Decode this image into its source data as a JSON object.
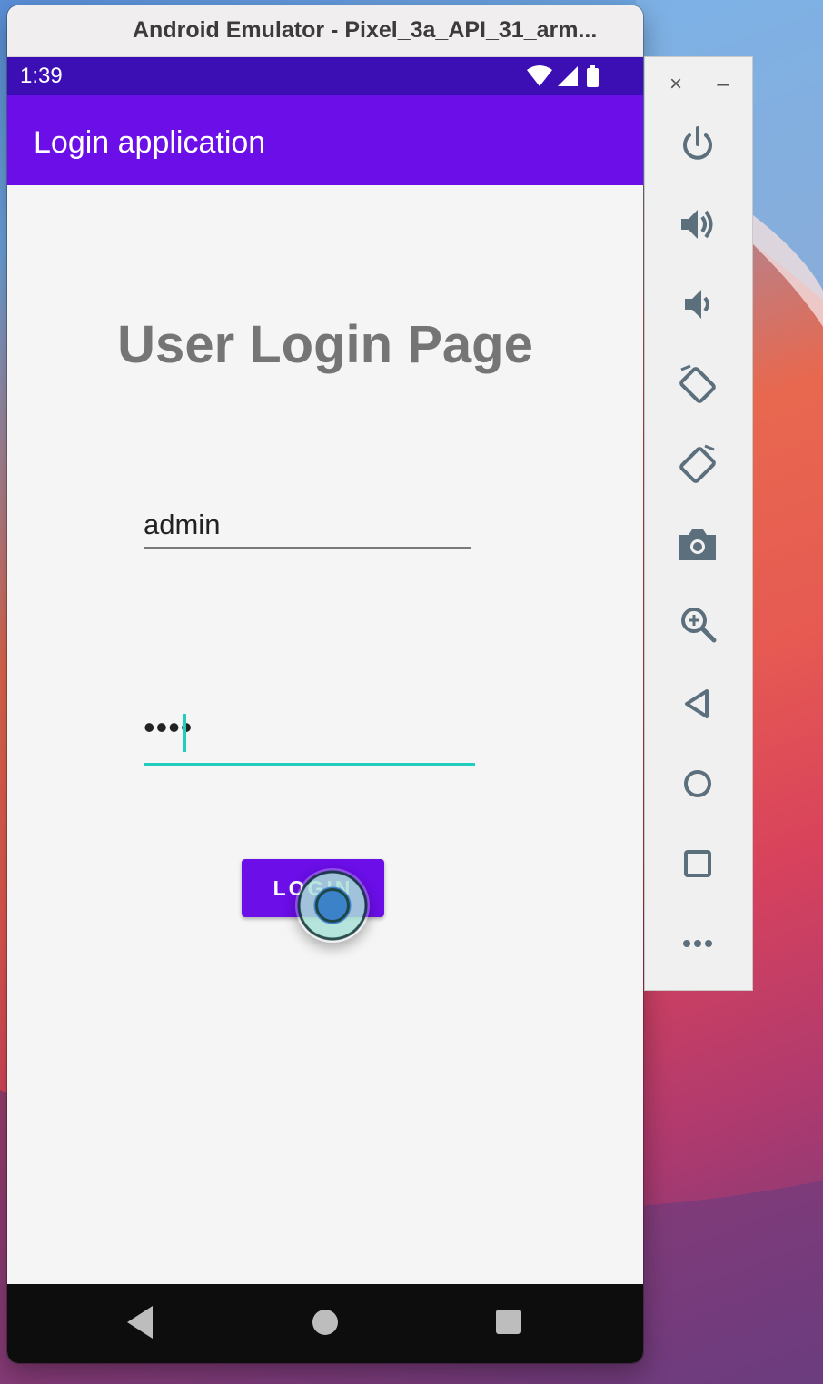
{
  "window": {
    "title": "Android Emulator - Pixel_3a_API_31_arm..."
  },
  "status_bar": {
    "time": "1:39",
    "icons": [
      "wifi-icon",
      "signal-icon",
      "battery-icon"
    ]
  },
  "app_bar": {
    "title": "Login application",
    "color": "#6b0ee8"
  },
  "login_page": {
    "heading": "User Login Page",
    "username_value": "admin",
    "password_masked": "••••",
    "login_button_label": "LOGIN",
    "accent_color": "#20cdbf"
  },
  "nav_bar": {
    "buttons": [
      "back-icon",
      "home-icon",
      "recents-icon"
    ]
  },
  "toolbar": {
    "close_glyph": "×",
    "minimize_glyph": "–",
    "buttons": [
      "power-icon",
      "volume-up-icon",
      "volume-down-icon",
      "rotate-left-icon",
      "rotate-right-icon",
      "camera-icon",
      "zoom-icon",
      "back-icon",
      "home-icon",
      "overview-icon",
      "more-icon"
    ]
  }
}
